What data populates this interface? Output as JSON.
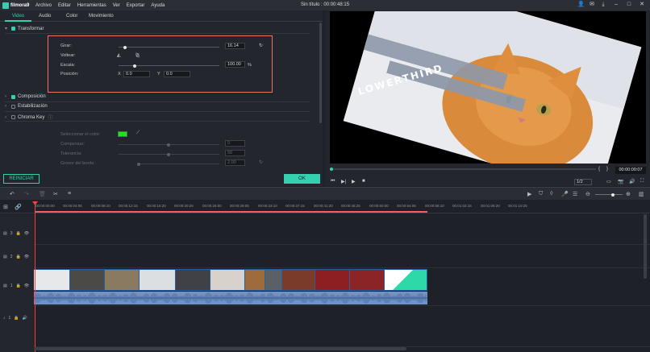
{
  "app": {
    "logo": "filmora9",
    "menu": [
      "Archivo",
      "Editar",
      "Herramientas",
      "Ver",
      "Exportar",
      "Ayuda"
    ],
    "window_title": "Sin título : 00:00:48:15"
  },
  "tabs": [
    "Video",
    "Audio",
    "Color",
    "Movimiento"
  ],
  "sections": {
    "transform": "Transformar",
    "composition": "Composición",
    "stabilization": "Estabilización",
    "chroma": "Chroma Key"
  },
  "transform": {
    "rotate_label": "Girar:",
    "rotate_value": "16.14",
    "rotate_level": 0.05,
    "flip_label": "Voltear:",
    "scale_label": "Escala:",
    "scale_value": "100.00",
    "scale_unit": "%",
    "scale_level": 0.14,
    "position_label": "Posición:",
    "x_label": "X",
    "x_value": "0.0",
    "y_label": "Y",
    "y_value": "0.0"
  },
  "chroma": {
    "select_color_label": "Seleccionar el color:",
    "selected_color": "#22e022",
    "offset_label": "Compensar:",
    "offset_value": "0",
    "tolerance_label": "Tolerancia:",
    "tolerance_value": "50",
    "edge_thickness_label": "Grosor del borde:",
    "edge_thickness_value": "2.00"
  },
  "buttons": {
    "reset": "REINICIAR",
    "ok": "OK"
  },
  "preview": {
    "overlay_text": "LOWERTHIRD",
    "timecode": "00:00:00:07",
    "ratio": "1/2"
  },
  "ruler": {
    "ticks": [
      "00:00:00:00",
      "00:00:04:05",
      "00:00:08:10",
      "00:00:12:15",
      "00:00:16:20",
      "00:00:20:25",
      "00:00:25:00",
      "00:00:29:05",
      "00:00:33:10",
      "00:00:37:15",
      "00:00:41:20",
      "00:00:45:25",
      "00:00:50:00",
      "00:00:54:05",
      "00:00:58:10",
      "00:01:02:15",
      "00:01:06:20",
      "00:01:10:25"
    ]
  },
  "tracks": {
    "t3": "3",
    "t2": "2",
    "t1": "1",
    "audio1": "1"
  },
  "colors": {
    "accent": "#35d0b0",
    "highlight_box": "#e8736a",
    "playhead": "#ff3d3d"
  }
}
